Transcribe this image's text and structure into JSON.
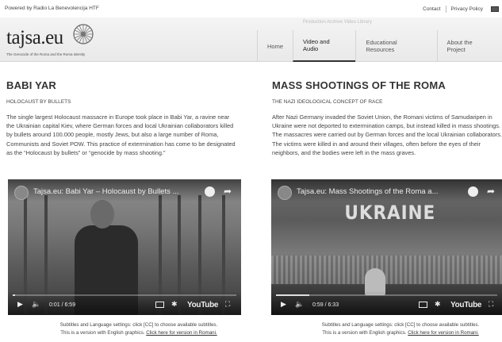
{
  "topbar": {
    "powered_by": "Powered by Radio La Benevolencija HTF",
    "contact": "Contact",
    "privacy": "Privacy Policy"
  },
  "header": {
    "logo": "tajsa.eu",
    "tagline": "The Genocide of the Roma and the Roma Identity",
    "nav": [
      "Home",
      "Video and Audio",
      "Educational Resources",
      "About the Project"
    ],
    "nav_ghost": "Production  Archive  Video Library"
  },
  "left": {
    "title": "BABI YAR",
    "subtitle": "HOLOCAUST BY BULLETS",
    "body": "The single largest Holocaust massacre in Europe took place in Babi Yar, a ravine near the Ukrainian capital Kiev, where German forces and local Ukrainian collaborators killed by bullets around 100.000 people, mostly Jews, but also a large number of Roma, Communists and Soviet POW. This practice of extermination has come to be designated as the “Holocaust by bullets” or “genocide by mass shooting.”",
    "video": {
      "title": "Tajsa.eu: Babi Yar – Holocaust by Bullets ...",
      "time": "0:01 / 6:59",
      "progress": 0.003
    },
    "note_line1": "Subtitles and Language settings: click [CC] to choose available subtitles.",
    "note_line2": "This is a version with English graphics.",
    "note_link": "Click here for version in Romani."
  },
  "right": {
    "title": "MASS SHOOTINGS OF THE ROMA",
    "subtitle": "THE NAZI IDEOLOGICAL CONCEPT OF RACE",
    "body": "After Nazi Germany invaded the Soviet Union, the Romani victims of Samudaripen in Ukraine were not deported to extermination camps, but instead killed in mass shootings. The massacres were carried out by German forces and the local Ukrainian collaborators. The victims were killed in and around their villages, often before the eyes of their neighbors, and the bodies were left in the mass graves.",
    "video": {
      "title": "Tajsa.eu: Mass Shootings of the Roma a...",
      "overlay": "UKRAINE",
      "time": "0:59 / 6:33",
      "progress": 0.15
    },
    "note_line1": "Subtitles and Language settings: click [CC] to choose available subtitles.",
    "note_line2": "This is a version with English graphics.",
    "note_link": "Click here for version in Romani."
  },
  "youtube": {
    "brand": "YouTube"
  },
  "icons": [
    "radhe-wheel-icon",
    "play-icon",
    "volume-icon",
    "cc-icon",
    "settings-icon",
    "fullscreen-icon",
    "watch-later-icon",
    "share-icon",
    "flag-icon"
  ]
}
